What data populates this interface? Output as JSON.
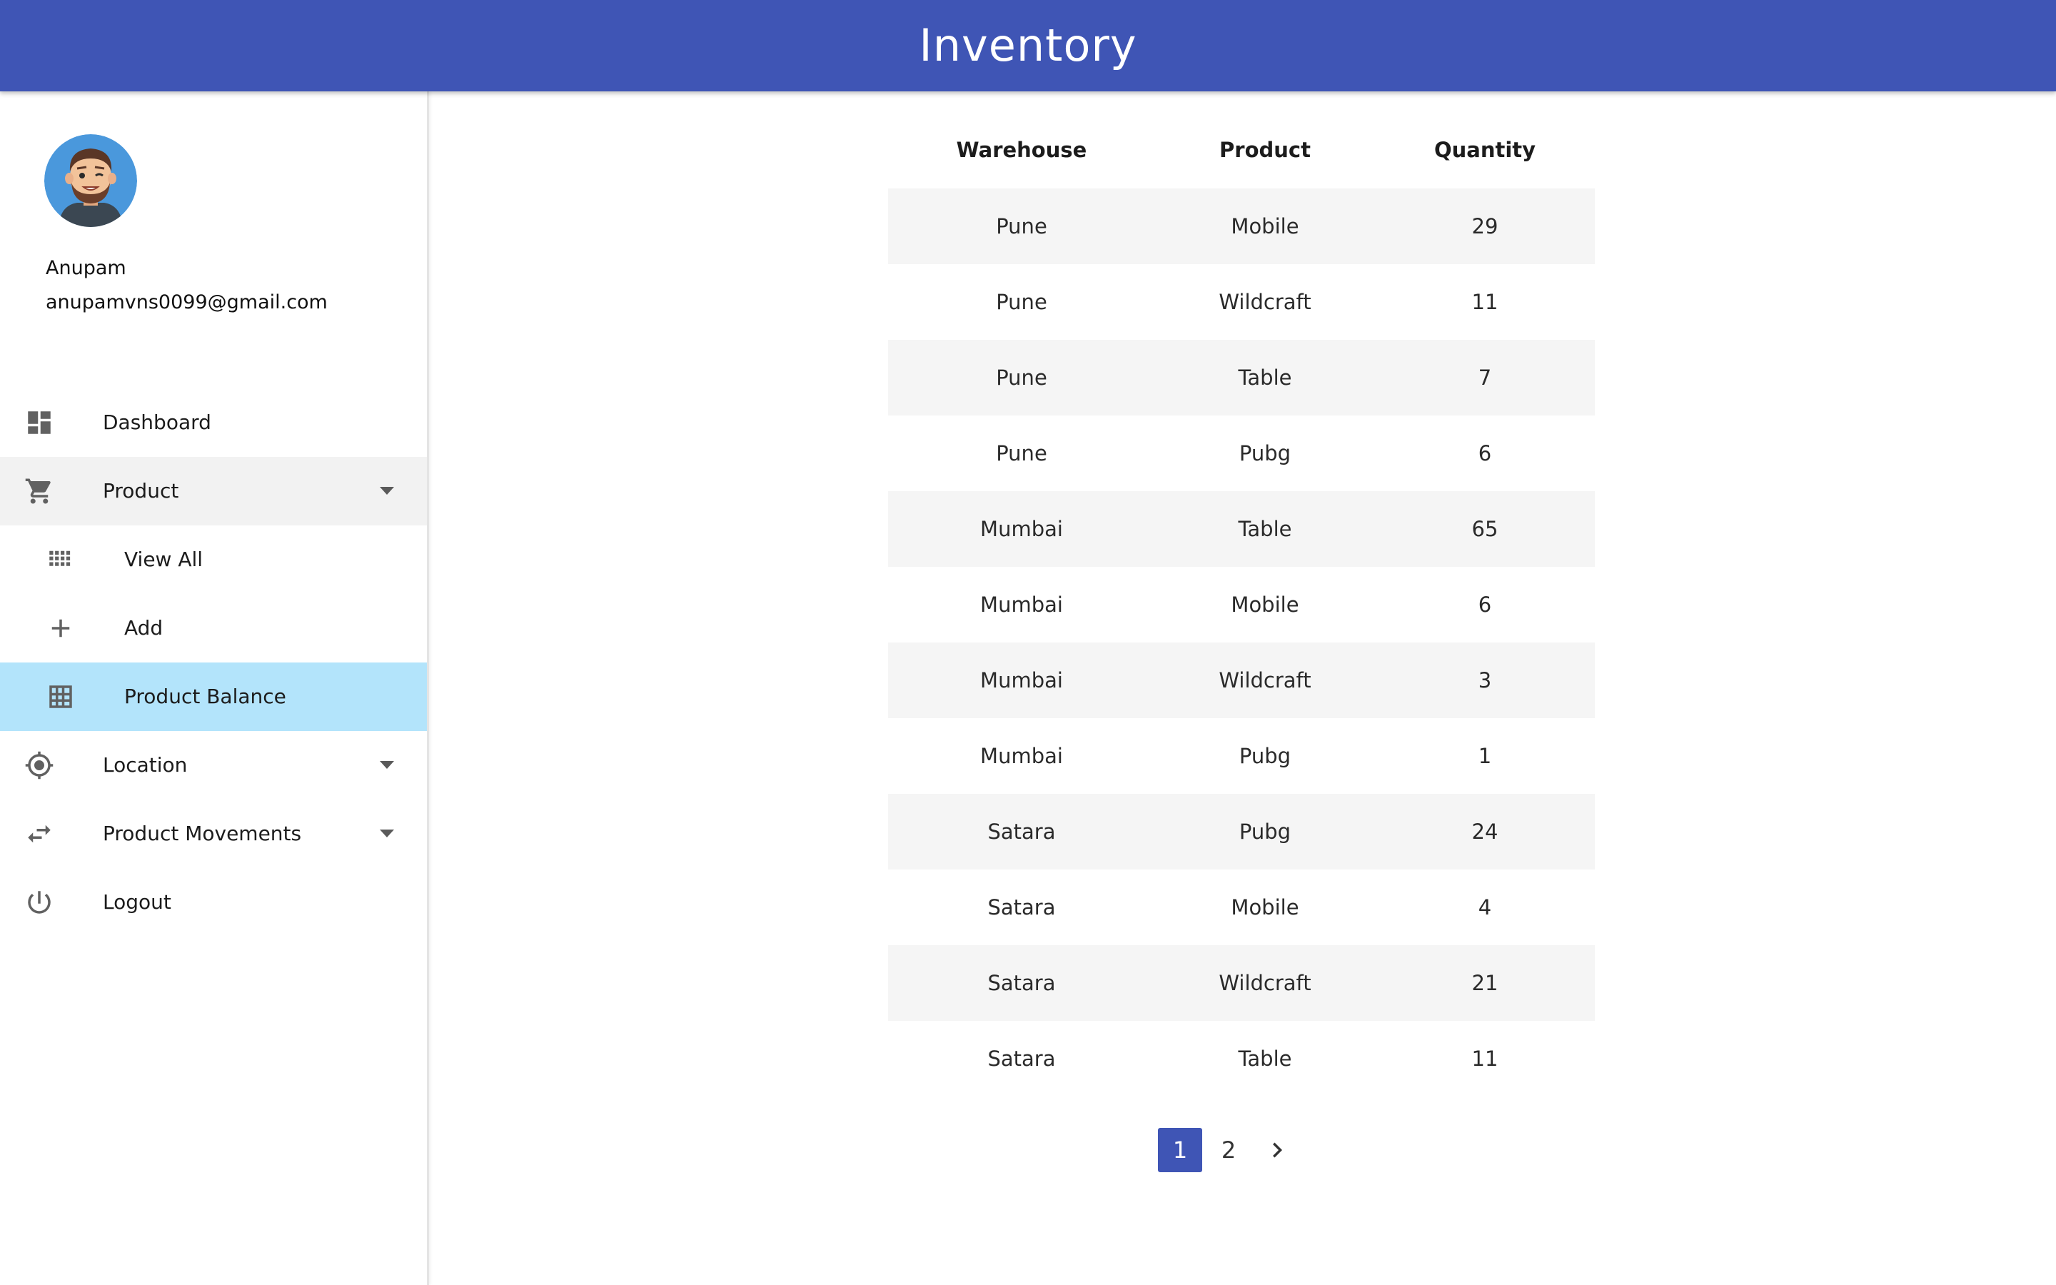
{
  "app": {
    "title": "Inventory"
  },
  "user": {
    "name": "Anupam",
    "email": "anupamvns0099@gmail.com"
  },
  "sidebar": {
    "items": [
      {
        "label": "Dashboard",
        "icon": "dashboard-icon"
      },
      {
        "label": "Product",
        "icon": "cart-icon",
        "expanded": true
      },
      {
        "label": "View All",
        "icon": "grid-icon"
      },
      {
        "label": "Add",
        "icon": "plus-icon"
      },
      {
        "label": "Product Balance",
        "icon": "table-icon",
        "active": true
      },
      {
        "label": "Location",
        "icon": "location-icon"
      },
      {
        "label": "Product Movements",
        "icon": "swap-icon"
      },
      {
        "label": "Logout",
        "icon": "power-icon"
      }
    ]
  },
  "table": {
    "headers": [
      "Warehouse",
      "Product",
      "Quantity"
    ],
    "rows": [
      [
        "Pune",
        "Mobile",
        "29"
      ],
      [
        "Pune",
        "Wildcraft",
        "11"
      ],
      [
        "Pune",
        "Table",
        "7"
      ],
      [
        "Pune",
        "Pubg",
        "6"
      ],
      [
        "Mumbai",
        "Table",
        "65"
      ],
      [
        "Mumbai",
        "Mobile",
        "6"
      ],
      [
        "Mumbai",
        "Wildcraft",
        "3"
      ],
      [
        "Mumbai",
        "Pubg",
        "1"
      ],
      [
        "Satara",
        "Pubg",
        "24"
      ],
      [
        "Satara",
        "Mobile",
        "4"
      ],
      [
        "Satara",
        "Wildcraft",
        "21"
      ],
      [
        "Satara",
        "Table",
        "11"
      ]
    ]
  },
  "pagination": {
    "pages": [
      "1",
      "2"
    ],
    "current": "1",
    "next_icon": "chevron-right-icon"
  },
  "colors": {
    "primary": "#3f55b5",
    "active_item": "#b3e4fb",
    "stripe": "#f5f5f5"
  }
}
